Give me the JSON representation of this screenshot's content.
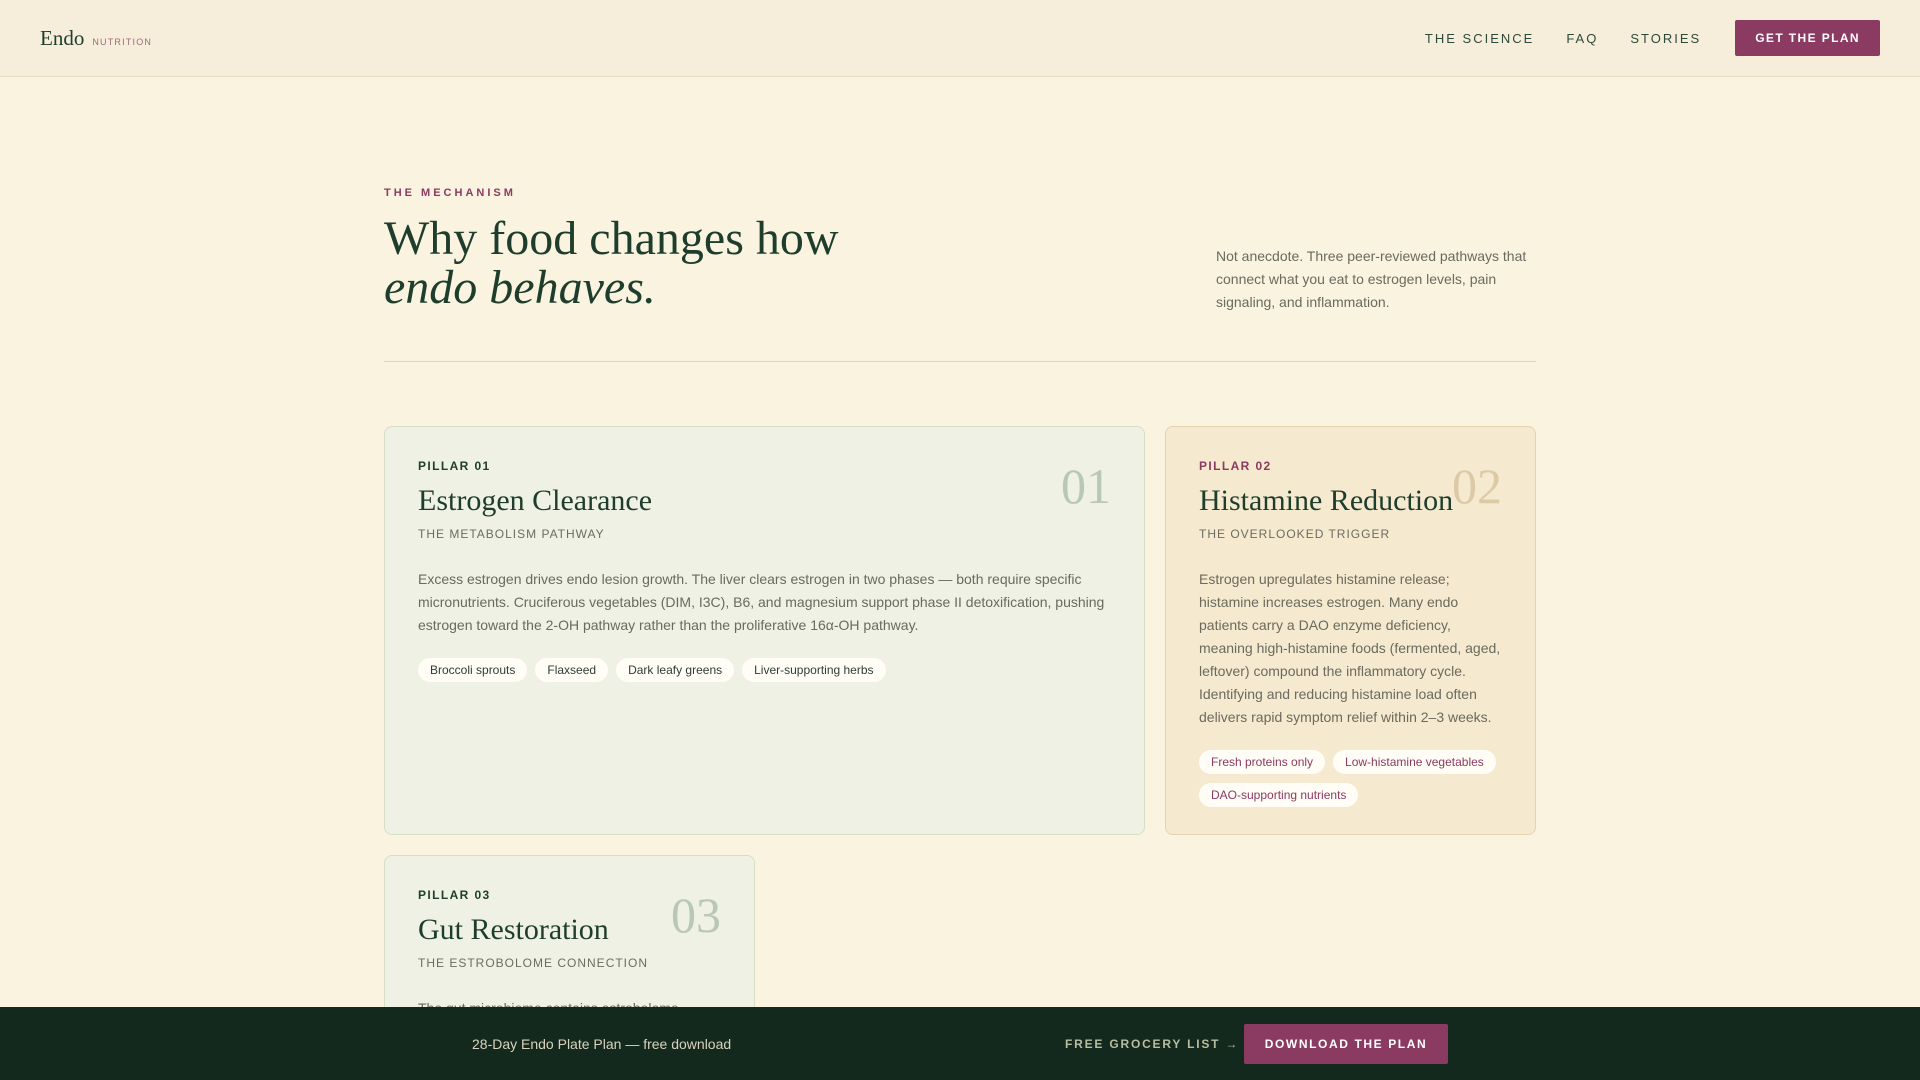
{
  "header": {
    "brand": "Endo",
    "brand_sub": "NUTRITION",
    "nav": [
      "THE SCIENCE",
      "FAQ",
      "STORIES"
    ],
    "cta": "GET THE PLAN"
  },
  "intro": {
    "eyebrow": "THE MECHANISM",
    "headline_line1": "Why food changes how",
    "headline_line2": "endo behaves.",
    "text": "Not anecdote. Three peer-reviewed pathways that connect what you eat to estrogen levels, pain signaling, and inflammation."
  },
  "pillars": [
    {
      "label": "PILLAR 01",
      "number": "01",
      "title": "Estrogen Clearance",
      "subtitle": "THE METABOLISM PATHWAY",
      "body": "Excess estrogen drives endo lesion growth. The liver clears estrogen in two phases — both require specific micronutrients. Cruciferous vegetables (DIM, I3C), B6, and magnesium support phase II detoxification, pushing estrogen toward the 2-OH pathway rather than the proliferative 16α-OH pathway.",
      "tags": [
        "Broccoli sprouts",
        "Flaxseed",
        "Dark leafy greens",
        "Liver-supporting herbs"
      ]
    },
    {
      "label": "PILLAR 02",
      "number": "02",
      "title": "Histamine Reduction",
      "subtitle": "THE OVERLOOKED TRIGGER",
      "body": "Estrogen upregulates histamine release; histamine increases estrogen. Many endo patients carry a DAO enzyme deficiency, meaning high-histamine foods (fermented, aged, leftover) compound the inflammatory cycle. Identifying and reducing histamine load often delivers rapid symptom relief within 2–3 weeks.",
      "tags": [
        "Fresh proteins only",
        "Low-histamine vegetables",
        "DAO-supporting nutrients"
      ]
    },
    {
      "label": "PILLAR 03",
      "number": "03",
      "title": "Gut Restoration",
      "subtitle": "THE ESTROBOLOME CONNECTION",
      "body": "The gut microbiome contains estrobolome"
    }
  ],
  "bottombar": {
    "text": "28-Day Endo Plate Plan — free download",
    "link": "FREE GROCERY LIST →",
    "cta": "DOWNLOAD THE PLAN"
  }
}
